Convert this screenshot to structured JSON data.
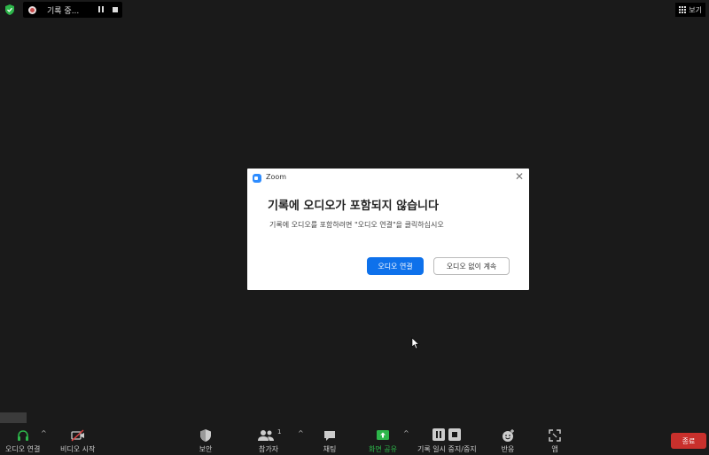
{
  "top_bar": {
    "recording_label": "기록 중...",
    "view_label": "보기"
  },
  "dialog": {
    "app_name": "Zoom",
    "close_symbol": "✕",
    "title": "기록에 오디오가 포함되지 않습니다",
    "message": "기록에 오디오를 포함하려면 \"오디오 연결\"을 클릭하십시오",
    "primary_button": "오디오 연결",
    "secondary_button": "오디오 없이 계속"
  },
  "toolbar": {
    "audio": "오디오 연결",
    "video": "비디오 시작",
    "security": "보안",
    "participants": "참가자",
    "participants_count": "1",
    "chat": "채팅",
    "share": "화면 공유",
    "recording": "기록 일시 중지/중지",
    "reactions": "반응",
    "apps": "앱",
    "end": "종료",
    "caret": "^"
  },
  "colors": {
    "background": "#1a1a1a",
    "primary_button": "#0e71eb",
    "share_green": "#2db64a",
    "end_red": "#c9302c"
  }
}
